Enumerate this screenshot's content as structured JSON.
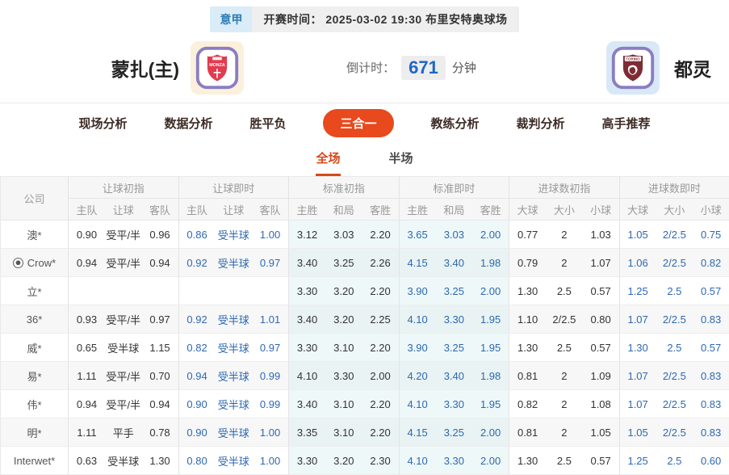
{
  "header": {
    "league": "意甲",
    "kickoff": "开赛时间： 2025-03-02 19:30   布里安特奥球场",
    "home_team": "蒙扎(主)",
    "away_team": "都灵",
    "home_logo": "monza-crest",
    "away_logo": "torino-crest",
    "countdown_label": "倒计时：",
    "countdown_value": "671",
    "countdown_unit": "分钟"
  },
  "nav": {
    "tabs": [
      {
        "id": "live-analysis",
        "label": "现场分析",
        "active": false
      },
      {
        "id": "data-analysis",
        "label": "数据分析",
        "active": false
      },
      {
        "id": "win-draw-loss",
        "label": "胜平负",
        "active": false
      },
      {
        "id": "three-in-one",
        "label": "三合一",
        "active": true
      },
      {
        "id": "coach-analysis",
        "label": "教练分析",
        "active": false
      },
      {
        "id": "referee-analysis",
        "label": "裁判分析",
        "active": false
      },
      {
        "id": "expert-picks",
        "label": "高手推荐",
        "active": false
      }
    ]
  },
  "subtabs": [
    {
      "id": "full-match",
      "label": "全场",
      "active": true
    },
    {
      "id": "half-match",
      "label": "半场",
      "active": false
    }
  ],
  "table": {
    "company_header": "公司",
    "groups": [
      {
        "id": "handicap-initial",
        "label": "让球初指",
        "cols": [
          "主队",
          "让球",
          "客队"
        ],
        "live": false,
        "tint": false
      },
      {
        "id": "handicap-live",
        "label": "让球即时",
        "cols": [
          "主队",
          "让球",
          "客队"
        ],
        "live": true,
        "tint": false
      },
      {
        "id": "standard-initial",
        "label": "标准初指",
        "cols": [
          "主胜",
          "和局",
          "客胜"
        ],
        "live": false,
        "tint": true
      },
      {
        "id": "standard-live",
        "label": "标准即时",
        "cols": [
          "主胜",
          "和局",
          "客胜"
        ],
        "live": true,
        "tint": true
      },
      {
        "id": "goals-initial",
        "label": "进球数初指",
        "cols": [
          "大球",
          "大小",
          "小球"
        ],
        "live": false,
        "tint": false
      },
      {
        "id": "goals-live",
        "label": "进球数即时",
        "cols": [
          "大球",
          "大小",
          "小球"
        ],
        "live": true,
        "tint": false
      }
    ],
    "rows": [
      {
        "company": "澳*",
        "icon": false,
        "cells": [
          [
            "0.90",
            "受平/半",
            "0.96"
          ],
          [
            "0.86",
            "受半球",
            "1.00"
          ],
          [
            "3.12",
            "3.03",
            "2.20"
          ],
          [
            "3.65",
            "3.03",
            "2.00"
          ],
          [
            "0.77",
            "2",
            "1.03"
          ],
          [
            "1.05",
            "2/2.5",
            "0.75"
          ]
        ]
      },
      {
        "company": "Crow*",
        "icon": true,
        "cells": [
          [
            "0.94",
            "受平/半",
            "0.94"
          ],
          [
            "0.92",
            "受半球",
            "0.97"
          ],
          [
            "3.40",
            "3.25",
            "2.26"
          ],
          [
            "4.15",
            "3.40",
            "1.98"
          ],
          [
            "0.79",
            "2",
            "1.07"
          ],
          [
            "1.06",
            "2/2.5",
            "0.82"
          ]
        ]
      },
      {
        "company": "立*",
        "icon": false,
        "cells": [
          [
            "",
            "",
            ""
          ],
          [
            "",
            "",
            ""
          ],
          [
            "3.30",
            "3.20",
            "2.20"
          ],
          [
            "3.90",
            "3.25",
            "2.00"
          ],
          [
            "1.30",
            "2.5",
            "0.57"
          ],
          [
            "1.25",
            "2.5",
            "0.57"
          ]
        ]
      },
      {
        "company": "36*",
        "icon": false,
        "cells": [
          [
            "0.93",
            "受平/半",
            "0.97"
          ],
          [
            "0.92",
            "受半球",
            "1.01"
          ],
          [
            "3.40",
            "3.20",
            "2.25"
          ],
          [
            "4.10",
            "3.30",
            "1.95"
          ],
          [
            "1.10",
            "2/2.5",
            "0.80"
          ],
          [
            "1.07",
            "2/2.5",
            "0.83"
          ]
        ]
      },
      {
        "company": "威*",
        "icon": false,
        "cells": [
          [
            "0.65",
            "受半球",
            "1.15"
          ],
          [
            "0.82",
            "受半球",
            "0.97"
          ],
          [
            "3.30",
            "3.10",
            "2.20"
          ],
          [
            "3.90",
            "3.25",
            "1.95"
          ],
          [
            "1.30",
            "2.5",
            "0.57"
          ],
          [
            "1.30",
            "2.5",
            "0.57"
          ]
        ]
      },
      {
        "company": "易*",
        "icon": false,
        "cells": [
          [
            "1.11",
            "受平/半",
            "0.70"
          ],
          [
            "0.94",
            "受半球",
            "0.99"
          ],
          [
            "4.10",
            "3.30",
            "2.00"
          ],
          [
            "4.20",
            "3.40",
            "1.98"
          ],
          [
            "0.81",
            "2",
            "1.09"
          ],
          [
            "1.07",
            "2/2.5",
            "0.83"
          ]
        ]
      },
      {
        "company": "伟*",
        "icon": false,
        "cells": [
          [
            "0.94",
            "受平/半",
            "0.94"
          ],
          [
            "0.90",
            "受半球",
            "0.99"
          ],
          [
            "3.40",
            "3.10",
            "2.20"
          ],
          [
            "4.10",
            "3.30",
            "1.95"
          ],
          [
            "0.82",
            "2",
            "1.08"
          ],
          [
            "1.07",
            "2/2.5",
            "0.83"
          ]
        ]
      },
      {
        "company": "明*",
        "icon": false,
        "cells": [
          [
            "1.11",
            "平手",
            "0.78"
          ],
          [
            "0.90",
            "受半球",
            "1.00"
          ],
          [
            "3.35",
            "3.10",
            "2.20"
          ],
          [
            "4.15",
            "3.25",
            "2.00"
          ],
          [
            "0.81",
            "2",
            "1.05"
          ],
          [
            "1.05",
            "2/2.5",
            "0.83"
          ]
        ]
      },
      {
        "company": "Interwet*",
        "icon": false,
        "cells": [
          [
            "0.63",
            "受半球",
            "1.30"
          ],
          [
            "0.80",
            "受半球",
            "1.00"
          ],
          [
            "3.30",
            "3.20",
            "2.30"
          ],
          [
            "4.10",
            "3.30",
            "2.00"
          ],
          [
            "1.30",
            "2.5",
            "0.57"
          ],
          [
            "1.25",
            "2.5",
            "0.60"
          ]
        ]
      }
    ]
  },
  "colors": {
    "accent_orange": "#e8491d",
    "subtab_orange": "#d6491a",
    "live_blue": "#2d68b2",
    "countdown_blue": "#1f66c7",
    "league_blue": "#2e7cb5",
    "league_badge_bg": "#d9ecf7",
    "standard_col_tint": "#eef8f8",
    "monza_red": "#e23b50",
    "torino_maroon": "#7d2b35",
    "crest_border_purple": "#8a7ec2",
    "home_tile_bg": "#fbf0dc",
    "away_tile_bg": "#d8e8f6"
  }
}
